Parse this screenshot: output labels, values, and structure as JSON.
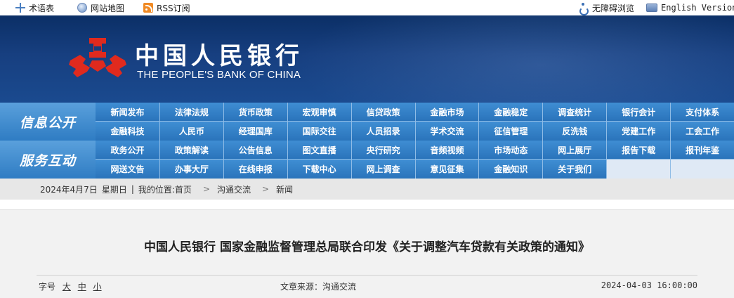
{
  "topbar": {
    "glossary": "术语表",
    "sitemap": "网站地图",
    "rss": "RSS订阅",
    "accessible": "无障碍浏览",
    "english": "English Version"
  },
  "banner": {
    "name_cn": "中国人民银行",
    "name_en": "THE PEOPLE'S BANK OF CHINA"
  },
  "nav": {
    "info": {
      "title": "信息公开",
      "row1": [
        "新闻发布",
        "法律法规",
        "货币政策",
        "宏观审慎",
        "信贷政策",
        "金融市场",
        "金融稳定",
        "调查统计",
        "银行会计",
        "支付体系"
      ],
      "row2": [
        "金融科技",
        "人民币",
        "经理国库",
        "国际交往",
        "人员招录",
        "学术交流",
        "征信管理",
        "反洗钱",
        "党建工作",
        "工会工作"
      ]
    },
    "service": {
      "title": "服务互动",
      "row1": [
        "政务公开",
        "政策解读",
        "公告信息",
        "图文直播",
        "央行研究",
        "音频视频",
        "市场动态",
        "网上展厅",
        "报告下载",
        "报刊年鉴"
      ],
      "row2": [
        "网送文告",
        "办事大厅",
        "在线申报",
        "下载中心",
        "网上调查",
        "意见征集",
        "金融知识",
        "关于我们"
      ]
    }
  },
  "breadcrumb": {
    "date": "2024年4月7日",
    "weekday": "星期日",
    "divider": "|",
    "location_label": "我的位置:",
    "items": [
      "首页",
      "沟通交流",
      "新闻"
    ],
    "sep": ">"
  },
  "article": {
    "title": "中国人民银行 国家金融监督管理总局联合印发《关于调整汽车贷款有关政策的通知》",
    "font_label": "字号",
    "font_large": "大",
    "font_medium": "中",
    "font_small": "小",
    "source": "文章来源：沟通交流",
    "datetime": "2024-04-03 16:00:00"
  }
}
